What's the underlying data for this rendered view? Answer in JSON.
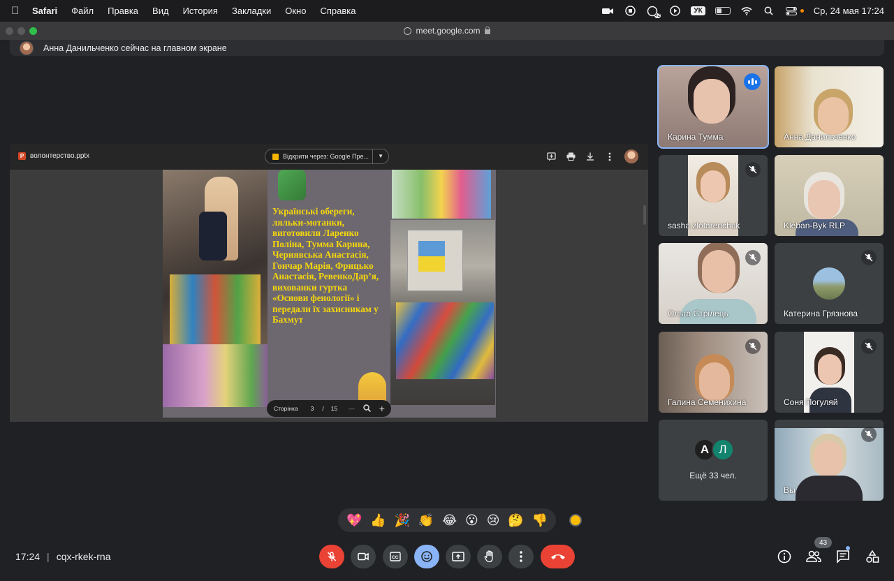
{
  "menubar": {
    "app_name": "Safari",
    "items": [
      "Файл",
      "Правка",
      "Вид",
      "История",
      "Закладки",
      "Окно",
      "Справка"
    ],
    "input_source": "УК",
    "clock": "Ср, 24 мая  17:24",
    "notification_count": "42"
  },
  "browser": {
    "url": "meet.google.com"
  },
  "banner": {
    "text": "Анна Данильченко сейчас на главном экране"
  },
  "viewer": {
    "file_name": "волонтерство.pptx",
    "open_with": "Відкрити через: Google Пре...",
    "page_label": "Сторінка",
    "page_current": "3",
    "page_sep": "/",
    "page_total": "15",
    "zoom_out": "—",
    "zoom_in": "+"
  },
  "slide": {
    "text": "Українські обереги, ляльки-мотанки, виготовили Ларенко Поліна, Тумма Карина, Чернявська Анастасія, Гончар Марія, Фрицько Анастасія, РевенкоДар’я, вихованки гуртка «Основи фенології» і передали їх захисникам у Бахмут",
    "text_color": "#f5d70a"
  },
  "participants": [
    {
      "name": "Карина Тумма",
      "speaking": true
    },
    {
      "name": "Анна Данильченко",
      "muted": false
    },
    {
      "name": "sasha zlotarenchuk",
      "muted": true
    },
    {
      "name": "Kleban-Byk RLP",
      "muted": false
    },
    {
      "name": "Ольга Стрілець",
      "muted": true
    },
    {
      "name": "Катерина Грязнова",
      "muted": true
    },
    {
      "name": "Галина Семенихина",
      "muted": true
    },
    {
      "name": "Соня Погуляй",
      "muted": true
    },
    {
      "name": "Вы",
      "muted": true
    }
  ],
  "more_tile": {
    "avatar1": "А",
    "avatar2": "Л",
    "label": "Ещё 33 чел."
  },
  "reactions": [
    "💖",
    "👍",
    "🎉",
    "👏",
    "😂",
    "😮",
    "😢",
    "🤔",
    "👎"
  ],
  "meeting": {
    "time": "17:24",
    "separator": "|",
    "code": "cqx-rkek-rna"
  },
  "people_count": "43",
  "colors": {
    "accent": "#8ab4f8",
    "end_call": "#ea4335",
    "speaking": "#1a73e8",
    "background": "#202124"
  }
}
